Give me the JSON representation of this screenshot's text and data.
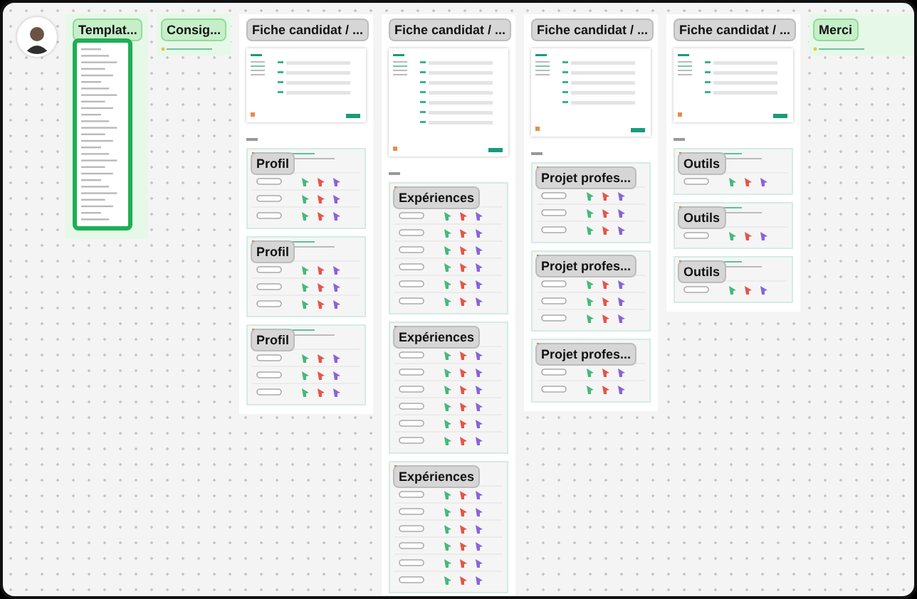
{
  "sections": [
    {
      "kind": "template",
      "title": "Templat..."
    },
    {
      "kind": "note",
      "title": "Consig..."
    },
    {
      "kind": "frame",
      "title": "Fiche candidat / ...",
      "cards": [
        {
          "title": "Profil",
          "rows": [
            {
              "kind": "choice"
            },
            {
              "kind": "choice"
            },
            {
              "kind": "choice"
            }
          ]
        },
        {
          "title": "Profil",
          "rows": [
            {
              "kind": "choice"
            },
            {
              "kind": "choice"
            },
            {
              "kind": "choice"
            }
          ]
        },
        {
          "title": "Profil",
          "rows": [
            {
              "kind": "choice"
            },
            {
              "kind": "choice"
            },
            {
              "kind": "choice"
            }
          ]
        }
      ]
    },
    {
      "kind": "frame",
      "title": "Fiche candidat / ...",
      "cards": [
        {
          "title": "Expériences",
          "rows": [
            {
              "kind": "choice"
            },
            {
              "kind": "choice"
            },
            {
              "kind": "choice"
            },
            {
              "kind": "choice"
            },
            {
              "kind": "choice"
            },
            {
              "kind": "choice"
            }
          ]
        },
        {
          "title": "Expériences",
          "rows": [
            {
              "kind": "choice"
            },
            {
              "kind": "choice"
            },
            {
              "kind": "choice"
            },
            {
              "kind": "choice"
            },
            {
              "kind": "choice"
            },
            {
              "kind": "choice"
            }
          ]
        },
        {
          "title": "Expériences",
          "rows": [
            {
              "kind": "choice"
            },
            {
              "kind": "choice"
            },
            {
              "kind": "choice"
            },
            {
              "kind": "choice"
            },
            {
              "kind": "choice"
            },
            {
              "kind": "choice"
            }
          ]
        }
      ]
    },
    {
      "kind": "frame",
      "title": "Fiche candidat / ...",
      "cards": [
        {
          "title": "Projet profes...",
          "rows": [
            {
              "kind": "choice"
            },
            {
              "kind": "choice"
            },
            {
              "kind": "choice"
            }
          ]
        },
        {
          "title": "Projet profes...",
          "rows": [
            {
              "kind": "choice"
            },
            {
              "kind": "choice"
            },
            {
              "kind": "choice"
            }
          ]
        },
        {
          "title": "Projet profes...",
          "rows": [
            {
              "kind": "choice"
            },
            {
              "kind": "choice"
            }
          ]
        }
      ]
    },
    {
      "kind": "frame",
      "title": "Fiche candidat / ...",
      "cards": [
        {
          "title": "Outils",
          "rows": [
            {
              "kind": "choice"
            }
          ]
        },
        {
          "title": "Outils",
          "rows": [
            {
              "kind": "choice"
            }
          ]
        },
        {
          "title": "Outils",
          "rows": [
            {
              "kind": "choice"
            }
          ]
        }
      ]
    },
    {
      "kind": "note",
      "title": "Merci"
    }
  ]
}
